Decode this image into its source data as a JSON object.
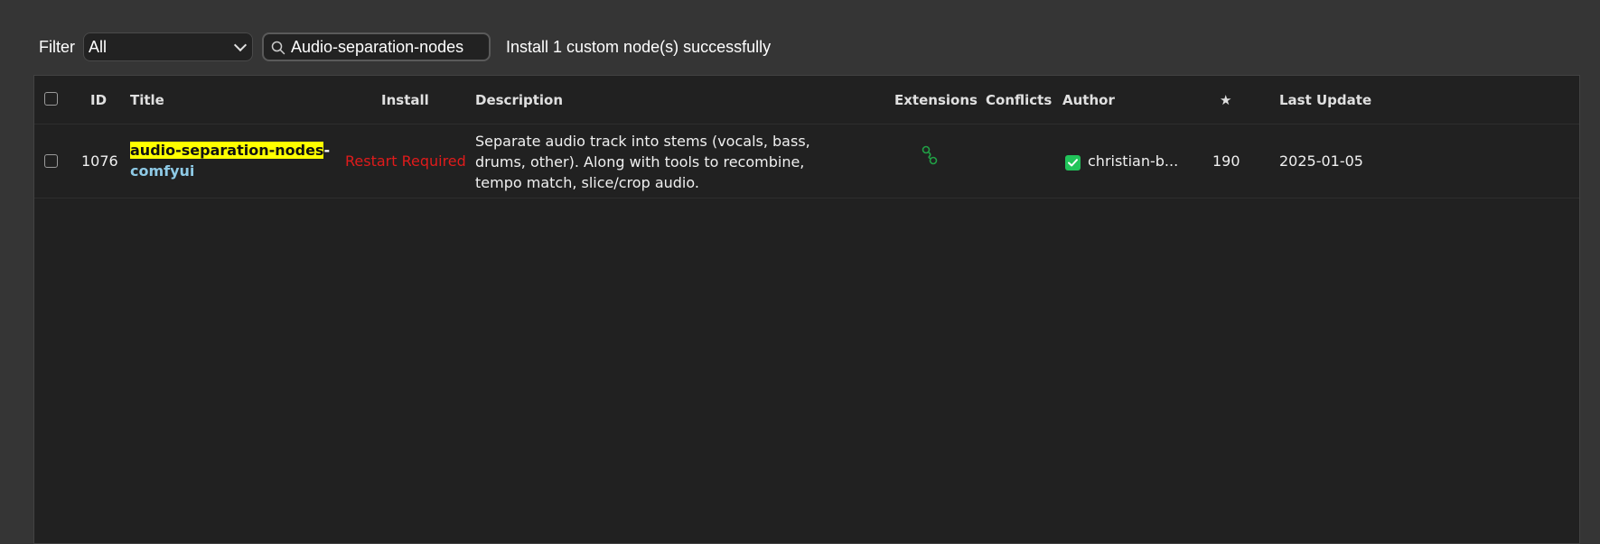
{
  "toolbar": {
    "filter_label": "Filter",
    "filter_value": "All",
    "search_value": "Audio-separation-nodes",
    "status_message": "Install 1 custom node(s) successfully"
  },
  "table": {
    "columns": {
      "id": "ID",
      "title": "Title",
      "install": "Install",
      "description": "Description",
      "extensions": "Extensions",
      "conflicts": "Conflicts",
      "author": "Author",
      "stars": "★",
      "last_update": "Last Update"
    },
    "rows": [
      {
        "id": "1076",
        "title_highlight": "audio-separation-nodes",
        "title_rest": "-",
        "title_line2": "comfyui",
        "install_status": "Restart Required",
        "description": "Separate audio track into stems (vocals, bass, drums, other). Along with tools to recombine, tempo match, slice/crop audio.",
        "extensions_icon": "extension-nodes-icon",
        "conflicts": "",
        "author": "christian-b...",
        "stars": "190",
        "last_update": "2025-01-05"
      }
    ]
  },
  "colors": {
    "background": "#353535",
    "grid_background": "#212121",
    "highlight": "#ffff00",
    "restart_required": "#e01b1b",
    "author_verified": "#21c45a",
    "extension_icon": "#21a045",
    "title_link": "#8ecae6"
  },
  "icons": {
    "search": "search-icon",
    "dropdown": "chevron-down-icon",
    "extensions": "extension-nodes-icon",
    "author_verified": "check-badge-icon"
  }
}
